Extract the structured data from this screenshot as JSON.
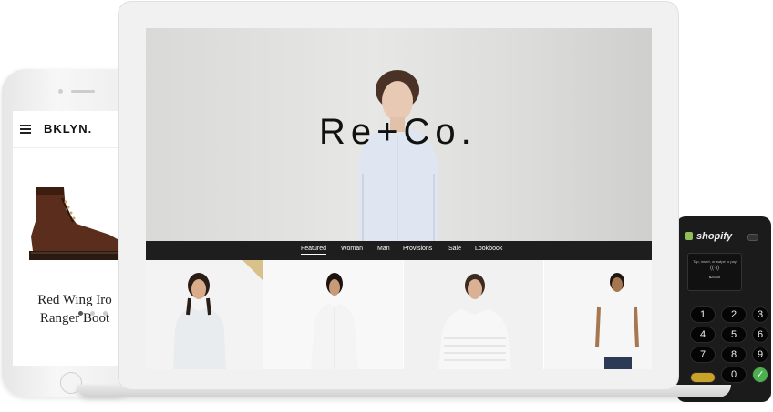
{
  "phone": {
    "brand": "BKLYN.",
    "product_title_line1": "Red Wing Iro",
    "product_title_line2": "Ranger Boot"
  },
  "laptop": {
    "store_logo": "Re+Co.",
    "nav": [
      "Featured",
      "Woman",
      "Man",
      "Provisions",
      "Sale",
      "Lookbook"
    ],
    "active_nav": "Featured"
  },
  "reader": {
    "brand": "shopify",
    "prompt": "Tap, insert, or swipe to pay",
    "amount": "$25.00",
    "keys": [
      "1",
      "2",
      "3",
      "4",
      "5",
      "6",
      "7",
      "8",
      "9",
      "0"
    ]
  },
  "colors": {
    "nav_bar": "#1e1e1e",
    "reader_body": "#1b1b1b",
    "ok_key": "#4caf50",
    "cancel_key": "#c9a227"
  }
}
